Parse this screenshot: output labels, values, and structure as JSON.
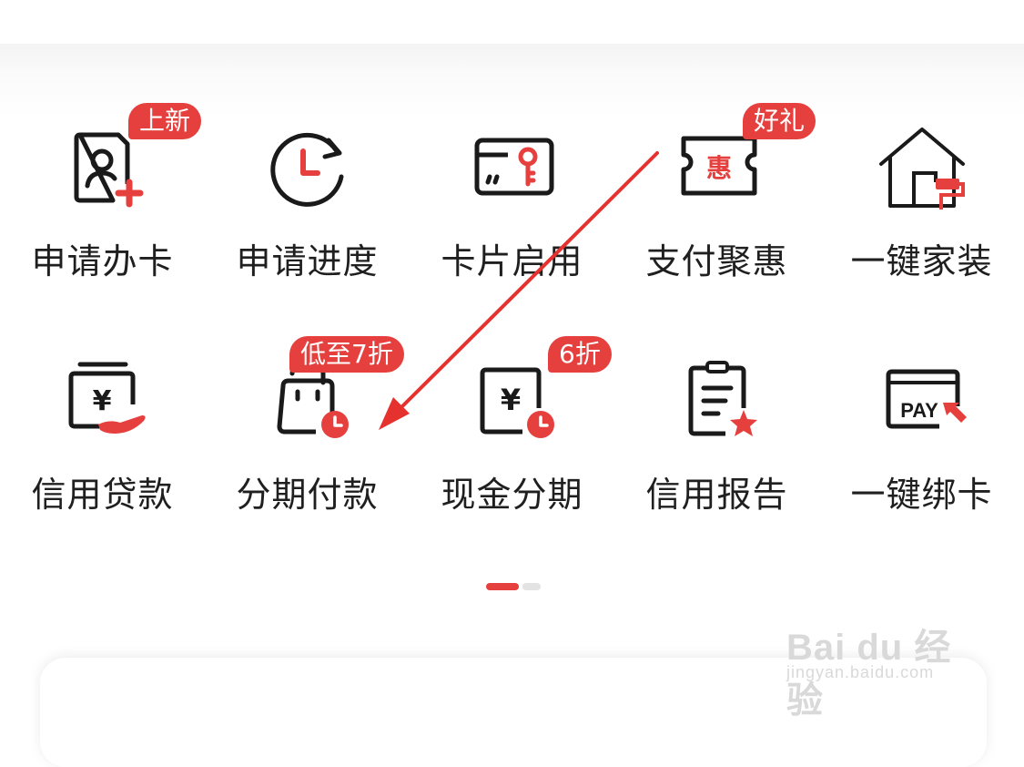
{
  "menu": {
    "row1": [
      {
        "label": "申请办卡",
        "icon": "apply-card-icon",
        "badge": "上新"
      },
      {
        "label": "申请进度",
        "icon": "progress-clock-icon",
        "badge": ""
      },
      {
        "label": "卡片启用",
        "icon": "card-key-icon",
        "badge": ""
      },
      {
        "label": "支付聚惠",
        "icon": "coupon-icon",
        "badge": "好礼",
        "icon_text": "惠"
      },
      {
        "label": "一键家装",
        "icon": "house-paint-icon",
        "badge": ""
      }
    ],
    "row2": [
      {
        "label": "信用贷款",
        "icon": "loan-hand-icon",
        "badge": "",
        "icon_text": "¥"
      },
      {
        "label": "分期付款",
        "icon": "shopping-bag-clock-icon",
        "badge": "低至7折"
      },
      {
        "label": "现金分期",
        "icon": "cash-clock-icon",
        "badge": "6折",
        "icon_text": "¥"
      },
      {
        "label": "信用报告",
        "icon": "report-star-icon",
        "badge": ""
      },
      {
        "label": "一键绑卡",
        "icon": "pay-card-icon",
        "badge": "",
        "icon_text": "PAY"
      }
    ]
  },
  "pagination": {
    "current_page": 1,
    "total_pages": 2
  },
  "watermark": {
    "logo_text": "Bai du 经验",
    "url": "jingyan.baidu.com"
  },
  "colors": {
    "accent": "#e5403e",
    "text": "#1f1f1f",
    "icon_stroke": "#1a1a1a"
  }
}
